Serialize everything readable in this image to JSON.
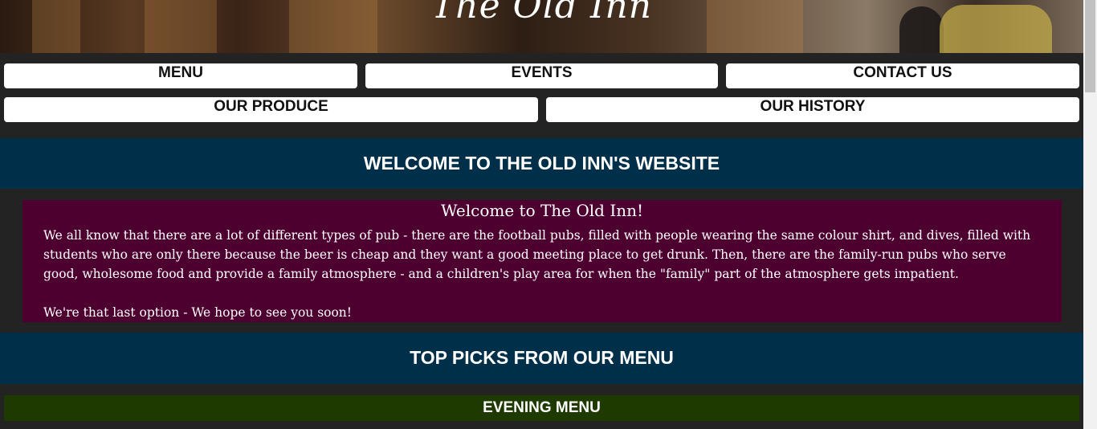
{
  "header": {
    "site_title": "The Old Inn"
  },
  "nav": {
    "menu": "MENU",
    "events": "EVENTS",
    "contact_us": "CONTACT US",
    "our_produce": "OUR PRODUCE",
    "our_history": "OUR HISTORY"
  },
  "welcome_section": {
    "heading": "WELCOME TO THE OLD INN'S WEBSITE",
    "box_title": "Welcome to The Old Inn!",
    "paragraph1": "We all know that there are a lot of different types of pub - there are the football pubs, filled with people wearing the same colour shirt, and dives, filled with students who are only there because the beer is cheap and they want a good meeting place to get drunk. Then, there are the family-run pubs who serve good, wholesome food and provide a family atmosphere - and a children's play area for when the \"family\" part of the atmosphere gets impatient.",
    "paragraph2": "We're that last option - We hope to see you soon!"
  },
  "top_picks": {
    "heading": "TOP PICKS FROM OUR MENU",
    "evening_menu": "EVENING MENU"
  },
  "colors": {
    "page_background": "#232323",
    "section_bar": "#003049",
    "welcome_box": "#4d0030",
    "evening_bar": "#1f3a00"
  }
}
